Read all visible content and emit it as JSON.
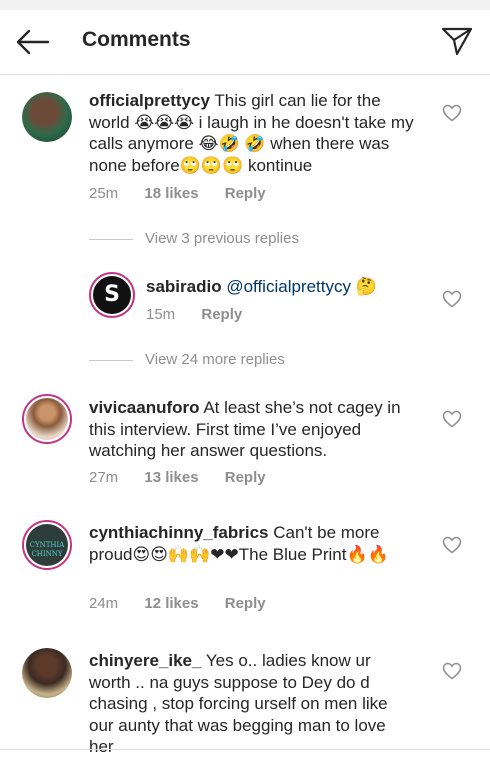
{
  "header": {
    "title": "Comments"
  },
  "comments": [
    {
      "username": "officialprettycy",
      "text": " This girl can lie for the world 😭😭😭 i laugh in he doesn't take my calls anymore 😂🤣 🤣 when there was none before🙄🙄🙄 kontinue",
      "time": "25m",
      "likes": "18 likes",
      "reply": "Reply"
    },
    {
      "username": "vivicaanuforo",
      "text": " At least she’s not cagey in this interview. First time I’ve enjoyed watching her answer questions.",
      "time": "27m",
      "likes": "13 likes",
      "reply": "Reply"
    },
    {
      "username": "cynthiachinny_fabrics",
      "text": " Can't be more proud😍😍🙌🙌❤❤The Blue Print🔥🔥",
      "time": "24m",
      "likes": "12 likes",
      "reply": "Reply"
    },
    {
      "username": "chinyere_ike_",
      "text": " Yes o.. ladies know ur worth .. na guys suppose to  Dey do d chasing , stop forcing urself on men like our aunty that was begging man to love her"
    }
  ],
  "view_previous": "View 3 previous replies",
  "reply": {
    "username": "sabiradio",
    "mention": "@officialprettycy",
    "emoji": " 🤔",
    "avatar_letter": "S",
    "time": "15m",
    "reply": "Reply"
  },
  "view_more": "View 24 more replies",
  "avatar_logo_text": "CYNTHIA CHINNY",
  "colors": {
    "accent": "#c13584",
    "mention": "#00376b",
    "muted": "#8e8e8e"
  },
  "icons": [
    "back-arrow-icon",
    "send-icon",
    "heart-icon"
  ]
}
